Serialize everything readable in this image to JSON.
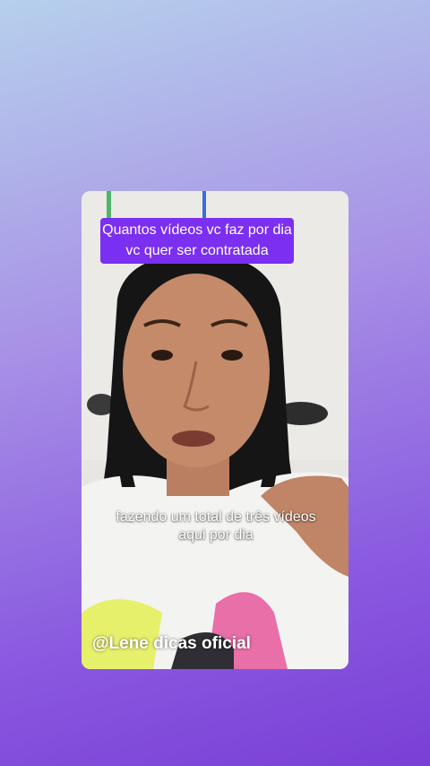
{
  "video": {
    "caption_top": "Quantos vídeos vc faz por dia vc quer ser contratada",
    "subtitle": "fazendo um total de três vídeos aqui por dia",
    "watermark": "@Lene dicas oficial"
  },
  "colors": {
    "caption_bg": "#7b2ff0",
    "background_top": "#b6d0ec",
    "background_bottom": "#7a3fd6"
  }
}
